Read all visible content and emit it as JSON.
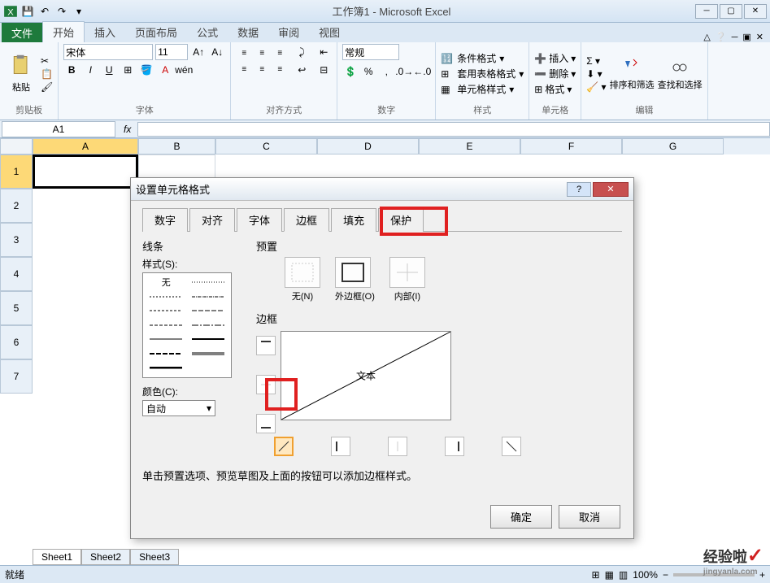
{
  "title": "工作簿1 - Microsoft Excel",
  "ribbon": {
    "file": "文件",
    "tabs": [
      "开始",
      "插入",
      "页面布局",
      "公式",
      "数据",
      "审阅",
      "视图"
    ],
    "active_tab": 0,
    "groups": {
      "clipboard": {
        "label": "剪贴板",
        "paste": "粘贴"
      },
      "font": {
        "label": "字体",
        "name": "宋体",
        "size": "11",
        "bold": "B",
        "italic": "I",
        "underline": "U"
      },
      "alignment": {
        "label": "对齐方式"
      },
      "number": {
        "label": "数字",
        "format": "常规"
      },
      "styles": {
        "label": "样式",
        "cond_fmt": "条件格式",
        "table_fmt": "套用表格格式",
        "cell_styles": "单元格样式"
      },
      "cells": {
        "label": "单元格",
        "insert": "插入",
        "delete": "删除",
        "format": "格式"
      },
      "editing": {
        "label": "编辑",
        "sort": "排序和筛选",
        "find": "查找和选择"
      }
    }
  },
  "name_box": "A1",
  "columns": [
    "A",
    "B",
    "C",
    "D",
    "E",
    "F",
    "G"
  ],
  "rows": [
    "1",
    "2",
    "3",
    "4",
    "5",
    "6",
    "7"
  ],
  "sheets": [
    "Sheet1",
    "Sheet2",
    "Sheet3"
  ],
  "status": {
    "ready": "就绪",
    "zoom": "100%"
  },
  "dialog": {
    "title": "设置单元格格式",
    "tabs": [
      "数字",
      "对齐",
      "字体",
      "边框",
      "填充",
      "保护"
    ],
    "active_tab": 3,
    "line": {
      "section": "线条",
      "style": "样式(S):",
      "none": "无",
      "color_label": "颜色(C):",
      "color": "自动"
    },
    "preset": {
      "section": "预置",
      "none": "无(N)",
      "outline": "外边框(O)",
      "inside": "内部(I)"
    },
    "border": {
      "section": "边框",
      "text": "文本"
    },
    "hint": "单击预置选项、预览草图及上面的按钮可以添加边框样式。",
    "ok": "确定",
    "cancel": "取消"
  },
  "watermark": {
    "text": "经验啦",
    "url": "jingyanla.com"
  }
}
